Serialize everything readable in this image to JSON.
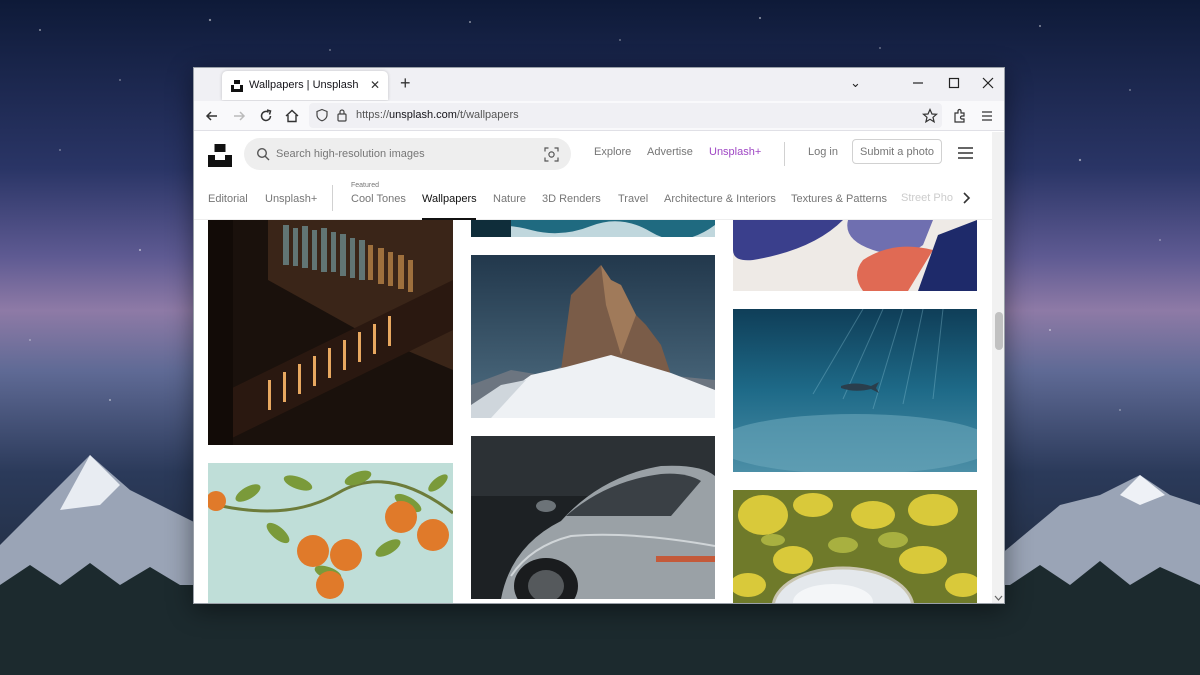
{
  "browser": {
    "tab_title": "Wallpapers | Unsplash",
    "url_prefix": "https://",
    "url_host": "unsplash.com",
    "url_path": "/t/wallpapers"
  },
  "header": {
    "search_placeholder": "Search high-resolution images",
    "links": {
      "explore": "Explore",
      "advertise": "Advertise",
      "unsplash_plus": "Unsplash+",
      "login": "Log in"
    },
    "submit_label": "Submit a photo"
  },
  "topics": {
    "editorial": "Editorial",
    "unsplash_plus": "Unsplash+",
    "featured_label": "Featured",
    "cool_tones": "Cool Tones",
    "wallpapers": "Wallpapers",
    "nature": "Nature",
    "renders": "3D Renders",
    "travel": "Travel",
    "architecture": "Architecture & Interiors",
    "textures": "Textures & Patterns",
    "street": "Street Pho"
  },
  "colors": {
    "unsplash_plus": "#9f47c4",
    "active_topic": "#111111",
    "muted_text": "#767676"
  },
  "icons": [
    "tab-favicon-icon",
    "close-icon",
    "plus-icon",
    "chevron-down-icon",
    "minimize-icon",
    "maximize-icon",
    "back-icon",
    "forward-icon",
    "reload-icon",
    "home-icon",
    "shield-icon",
    "lock-icon",
    "star-icon",
    "extensions-icon",
    "menu-icon",
    "search-icon",
    "visual-search-icon",
    "hamburger-icon",
    "chevron-right-icon"
  ]
}
